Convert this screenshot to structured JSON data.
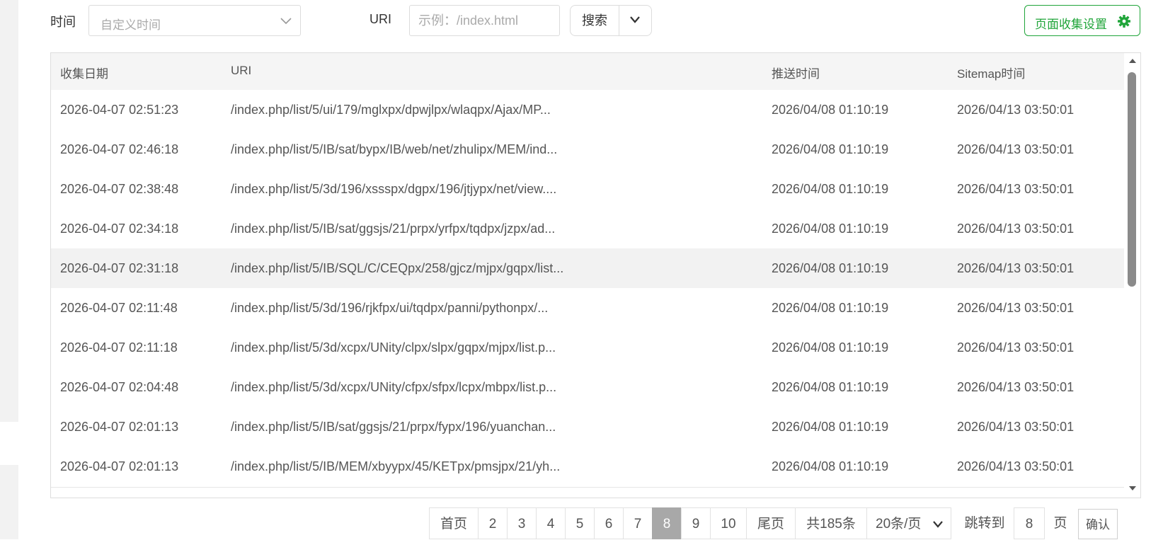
{
  "filters": {
    "time_label": "时间",
    "time_placeholder": "自定义时间",
    "uri_label": "URI",
    "uri_placeholder": "示例：/index.html",
    "search_label": "搜索",
    "settings_label": "页面收集设置"
  },
  "table": {
    "headers": [
      "收集日期",
      "URI",
      "推送时间",
      "Sitemap时间"
    ],
    "rows": [
      [
        "2026-04-07 02:51:23",
        "/index.php/list/5/ui/179/mglxpx/dpwjlpx/wlaqpx/Ajax/MP...",
        "2026/04/08 01:10:19",
        "2026/04/13 03:50:01"
      ],
      [
        "2026-04-07 02:46:18",
        "/index.php/list/5/IB/sat/bypx/IB/web/net/zhulipx/MEM/ind...",
        "2026/04/08 01:10:19",
        "2026/04/13 03:50:01"
      ],
      [
        "2026-04-07 02:38:48",
        "/index.php/list/5/3d/196/xssspx/dgpx/196/jtjypx/net/view....",
        "2026/04/08 01:10:19",
        "2026/04/13 03:50:01"
      ],
      [
        "2026-04-07 02:34:18",
        "/index.php/list/5/IB/sat/ggsjs/21/prpx/yrfpx/tqdpx/jzpx/ad...",
        "2026/04/08 01:10:19",
        "2026/04/13 03:50:01"
      ],
      [
        "2026-04-07 02:31:18",
        "/index.php/list/5/IB/SQL/C/CEQpx/258/gjcz/mjpx/gqpx/list...",
        "2026/04/08 01:10:19",
        "2026/04/13 03:50:01"
      ],
      [
        "2026-04-07 02:11:48",
        "/index.php/list/5/3d/196/rjkfpx/ui/tqdpx/panni/pythonpx/...",
        "2026/04/08 01:10:19",
        "2026/04/13 03:50:01"
      ],
      [
        "2026-04-07 02:11:18",
        "/index.php/list/5/3d/xcpx/UNity/clpx/slpx/gqpx/mjpx/list.p...",
        "2026/04/08 01:10:19",
        "2026/04/13 03:50:01"
      ],
      [
        "2026-04-07 02:04:48",
        "/index.php/list/5/3d/xcpx/UNity/cfpx/sfpx/lcpx/mbpx/list.p...",
        "2026/04/08 01:10:19",
        "2026/04/13 03:50:01"
      ],
      [
        "2026-04-07 02:01:13",
        "/index.php/list/5/IB/sat/ggsjs/21/prpx/fypx/196/yuanchan...",
        "2026/04/08 01:10:19",
        "2026/04/13 03:50:01"
      ],
      [
        "2026-04-07 02:01:13",
        "/index.php/list/5/IB/MEM/xbyypx/45/KETpx/pmsjpx/21/yh...",
        "2026/04/08 01:10:19",
        "2026/04/13 03:50:01"
      ]
    ]
  },
  "pagination": {
    "first": "首页",
    "pages": [
      "2",
      "3",
      "4",
      "5",
      "6",
      "7",
      "8",
      "9",
      "10"
    ],
    "current_page": "8",
    "last": "尾页",
    "total": "共185条",
    "page_size": "20条/页",
    "jump_label": "跳转到",
    "jump_value": "8",
    "page_unit": "页",
    "confirm": "确认"
  },
  "colors": {
    "accent": "#20a53a",
    "active_page": "#a8a8a8"
  },
  "icons": [
    "chevron-down-icon",
    "gear-icon",
    "scroll-up-icon",
    "scroll-down-icon"
  ]
}
